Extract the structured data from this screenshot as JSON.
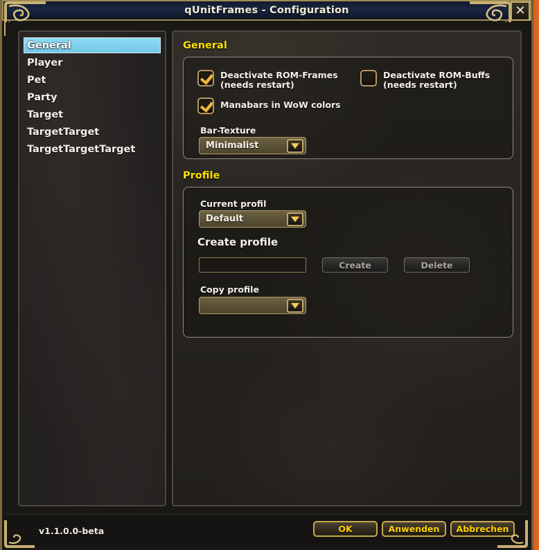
{
  "window": {
    "title": "qUnitFrames - Configuration",
    "close_label": "✕",
    "accent_gold": "#ffd100",
    "section_heading_color": "#ffe000",
    "selection_color": "#7fd2ec"
  },
  "sidebar": {
    "items": [
      {
        "label": "General",
        "selected": true
      },
      {
        "label": "Player",
        "selected": false
      },
      {
        "label": "Pet",
        "selected": false
      },
      {
        "label": "Party",
        "selected": false
      },
      {
        "label": "Target",
        "selected": false
      },
      {
        "label": "TargetTarget",
        "selected": false
      },
      {
        "label": "TargetTargetTarget",
        "selected": false
      }
    ]
  },
  "general_section": {
    "heading": "General",
    "checkboxes": [
      {
        "label": "Deactivate ROM-Frames (needs restart)",
        "checked": true
      },
      {
        "label": "Deactivate ROM-Buffs (needs restart)",
        "checked": false
      },
      {
        "label": "Manabars in WoW colors",
        "checked": true
      }
    ],
    "bar_texture": {
      "label": "Bar-Texture",
      "value": "Minimalist"
    }
  },
  "profile_section": {
    "heading": "Profile",
    "current_profile": {
      "label": "Current profil",
      "value": "Default"
    },
    "create_profile": {
      "label": "Create profile",
      "input_value": "",
      "input_placeholder": "",
      "create_button": "Create",
      "delete_button": "Delete"
    },
    "copy_profile": {
      "label": "Copy profile",
      "value": ""
    }
  },
  "footer": {
    "version": "v1.1.0.0-beta",
    "buttons": [
      {
        "label": "OK"
      },
      {
        "label": "Anwenden"
      },
      {
        "label": "Abbrechen"
      }
    ]
  }
}
